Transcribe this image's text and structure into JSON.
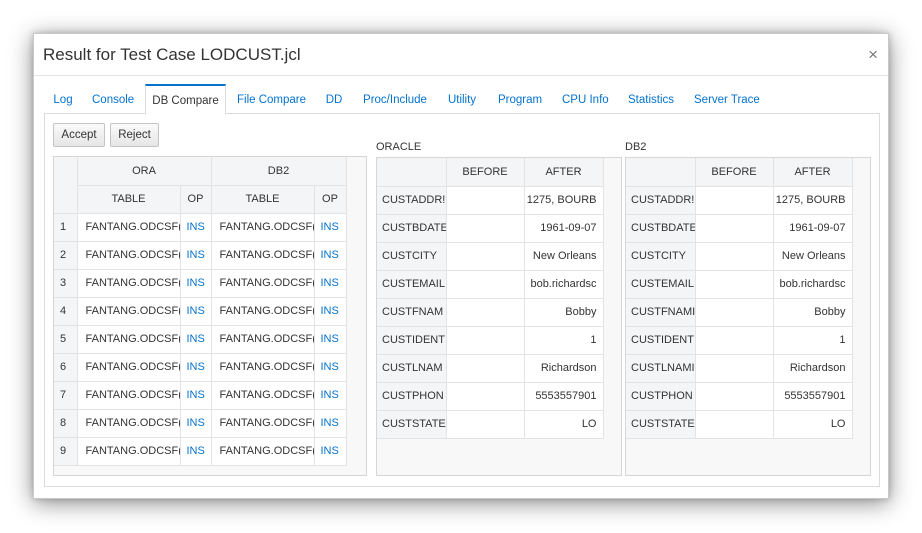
{
  "dialog": {
    "title": "Result for Test Case LODCUST.jcl",
    "close_glyph": "×"
  },
  "tabs": [
    {
      "label": "Log"
    },
    {
      "label": "Console"
    },
    {
      "label": "DB Compare"
    },
    {
      "label": "File Compare"
    },
    {
      "label": "DD"
    },
    {
      "label": "Proc/Include"
    },
    {
      "label": "Utility"
    },
    {
      "label": "Program"
    },
    {
      "label": "CPU Info"
    },
    {
      "label": "Statistics"
    },
    {
      "label": "Server Trace"
    }
  ],
  "active_tab": "DB Compare",
  "buttons": {
    "accept": "Accept",
    "reject": "Reject"
  },
  "left_grid": {
    "group_headers": [
      "ORA",
      "DB2"
    ],
    "columns": [
      "TABLE",
      "OP",
      "TABLE",
      "OP"
    ],
    "rows": [
      {
        "num": "1",
        "ora_table": "FANTANG.ODCSF(",
        "ora_op": "INS",
        "db2_table": "FANTANG.ODCSF(",
        "db2_op": "INS"
      },
      {
        "num": "2",
        "ora_table": "FANTANG.ODCSF(",
        "ora_op": "INS",
        "db2_table": "FANTANG.ODCSF(",
        "db2_op": "INS"
      },
      {
        "num": "3",
        "ora_table": "FANTANG.ODCSF(",
        "ora_op": "INS",
        "db2_table": "FANTANG.ODCSF(",
        "db2_op": "INS"
      },
      {
        "num": "4",
        "ora_table": "FANTANG.ODCSF(",
        "ora_op": "INS",
        "db2_table": "FANTANG.ODCSF(",
        "db2_op": "INS"
      },
      {
        "num": "5",
        "ora_table": "FANTANG.ODCSF(",
        "ora_op": "INS",
        "db2_table": "FANTANG.ODCSF(",
        "db2_op": "INS"
      },
      {
        "num": "6",
        "ora_table": "FANTANG.ODCSF(",
        "ora_op": "INS",
        "db2_table": "FANTANG.ODCSF(",
        "db2_op": "INS"
      },
      {
        "num": "7",
        "ora_table": "FANTANG.ODCSF(",
        "ora_op": "INS",
        "db2_table": "FANTANG.ODCSF(",
        "db2_op": "INS"
      },
      {
        "num": "8",
        "ora_table": "FANTANG.ODCSF(",
        "ora_op": "INS",
        "db2_table": "FANTANG.ODCSF(",
        "db2_op": "INS"
      },
      {
        "num": "9",
        "ora_table": "FANTANG.ODCSF(",
        "ora_op": "INS",
        "db2_table": "FANTANG.ODCSF(",
        "db2_op": "INS"
      }
    ]
  },
  "oracle": {
    "label": "ORACLE",
    "columns": [
      "BEFORE",
      "AFTER"
    ],
    "rows": [
      {
        "field": "CUSTADDR!",
        "before": "",
        "after": "1275, BOURB"
      },
      {
        "field": "CUSTBDATE",
        "before": "",
        "after": "1961-09-07"
      },
      {
        "field": "CUSTCITY",
        "before": "",
        "after": "New Orleans"
      },
      {
        "field": "CUSTEMAIL",
        "before": "",
        "after": "bob.richardsc"
      },
      {
        "field": "CUSTFNAM",
        "before": "",
        "after": "Bobby"
      },
      {
        "field": "CUSTIDENT",
        "before": "",
        "after": "1"
      },
      {
        "field": "CUSTLNAM",
        "before": "",
        "after": "Richardson"
      },
      {
        "field": "CUSTPHON",
        "before": "",
        "after": "5553557901"
      },
      {
        "field": "CUSTSTATE",
        "before": "",
        "after": "LO"
      }
    ]
  },
  "db2": {
    "label": "DB2",
    "columns": [
      "BEFORE",
      "AFTER"
    ],
    "rows": [
      {
        "field": "CUSTADDR!",
        "before": "",
        "after": "1275, BOURB"
      },
      {
        "field": "CUSTBDATE",
        "before": "",
        "after": "1961-09-07"
      },
      {
        "field": "CUSTCITY",
        "before": "",
        "after": "New Orleans"
      },
      {
        "field": "CUSTEMAIL",
        "before": "",
        "after": "bob.richardsc"
      },
      {
        "field": "CUSTFNAMI",
        "before": "",
        "after": "Bobby"
      },
      {
        "field": "CUSTIDENT",
        "before": "",
        "after": "1"
      },
      {
        "field": "CUSTLNAMI",
        "before": "",
        "after": "Richardson"
      },
      {
        "field": "CUSTPHON",
        "before": "",
        "after": "5553557901"
      },
      {
        "field": "CUSTSTATE",
        "before": "",
        "after": "LO"
      }
    ]
  },
  "colors": {
    "accent": "#0572ce",
    "header_bg": "#f3f5f7",
    "border": "#dcdcdc"
  }
}
